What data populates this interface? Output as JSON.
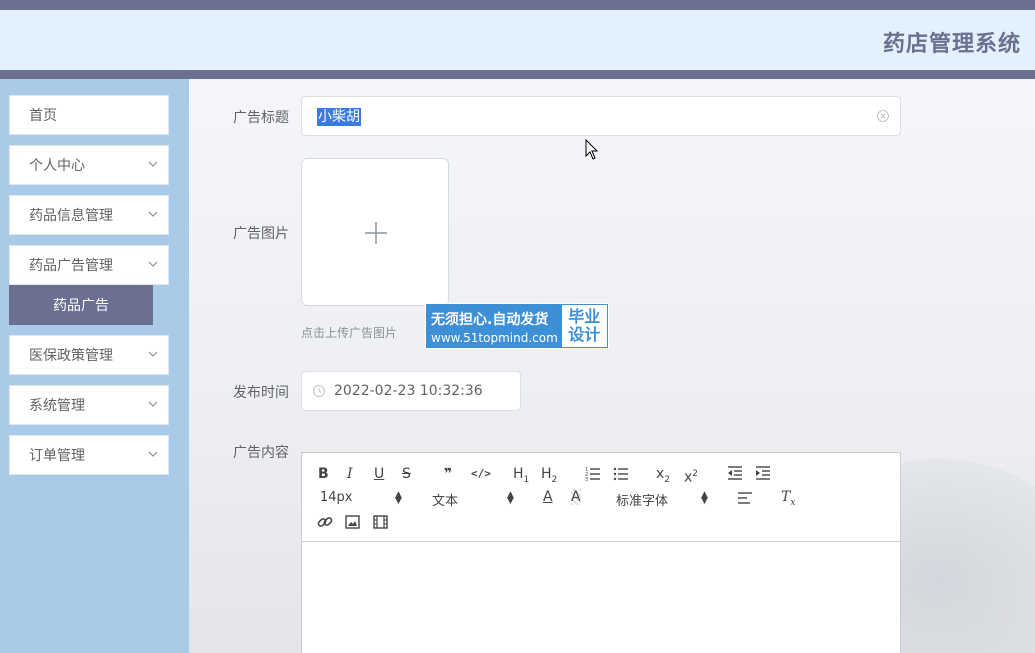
{
  "app": {
    "title": "药店管理系统"
  },
  "sidebar": {
    "items": [
      {
        "label": "首页",
        "has_arrow": false
      },
      {
        "label": "个人中心",
        "has_arrow": true
      },
      {
        "label": "药品信息管理",
        "has_arrow": true
      },
      {
        "label": "药品广告管理",
        "has_arrow": true
      },
      {
        "label": "医保政策管理",
        "has_arrow": true
      },
      {
        "label": "系统管理",
        "has_arrow": true
      },
      {
        "label": "订单管理",
        "has_arrow": true
      }
    ],
    "active_sub": {
      "label": "药品广告"
    }
  },
  "form": {
    "title_label": "广告标题",
    "title_value": "小柴胡",
    "image_label": "广告图片",
    "upload_tip": "点击上传广告图片",
    "time_label": "发布时间",
    "time_value": "2022-02-23 10:32:36",
    "content_label": "广告内容"
  },
  "editor": {
    "font_size": "14px",
    "text_type": "文本",
    "font_family": "标准字体"
  },
  "watermark": {
    "line1": "无须担心.自动发货",
    "line2": "www.51topmind.com",
    "right1": "毕业",
    "right2": "设计"
  },
  "colors": {
    "accent": "#6c7090",
    "header_bg": "#e2f1fb",
    "sidebar_bg": "#a9cbe8",
    "selection": "#3b7be0",
    "watermark_bg": "#3d8fd6"
  }
}
